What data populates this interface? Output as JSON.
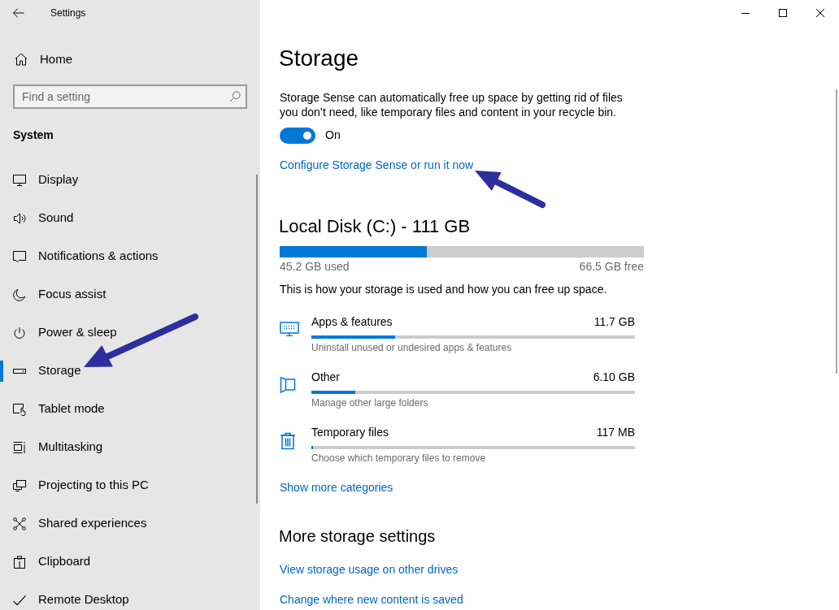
{
  "window": {
    "title": "Settings"
  },
  "sidebar": {
    "home": "Home",
    "search": {
      "placeholder": "Find a setting"
    },
    "section": "System",
    "items": [
      {
        "label": "Display",
        "selected": false
      },
      {
        "label": "Sound",
        "selected": false
      },
      {
        "label": "Notifications & actions",
        "selected": false
      },
      {
        "label": "Focus assist",
        "selected": false
      },
      {
        "label": "Power & sleep",
        "selected": false
      },
      {
        "label": "Storage",
        "selected": true
      },
      {
        "label": "Tablet mode",
        "selected": false
      },
      {
        "label": "Multitasking",
        "selected": false
      },
      {
        "label": "Projecting to this PC",
        "selected": false
      },
      {
        "label": "Shared experiences",
        "selected": false
      },
      {
        "label": "Clipboard",
        "selected": false
      },
      {
        "label": "Remote Desktop",
        "selected": false
      }
    ]
  },
  "page": {
    "title": "Storage",
    "description": "Storage Sense can automatically free up space by getting rid of files you don’t need, like temporary files and content in your recycle bin.",
    "storage_sense": {
      "on": true,
      "label": "On"
    },
    "configure_link": "Configure Storage Sense or run it now",
    "drive": {
      "title": "Local Disk (C:) - 111 GB",
      "level": 0.405,
      "used": "45.2 GB used",
      "free": "66.5 GB free"
    },
    "usage_note": "This is how your storage is used and how you can free up space.",
    "categories": [
      {
        "name": "Apps & features",
        "size": "11.7 GB",
        "level": 0.26,
        "description": "Uninstall unused or undesired apps & features"
      },
      {
        "name": "Other",
        "size": "6.10 GB",
        "level": 0.135,
        "description": "Manage other large folders"
      },
      {
        "name": "Temporary files",
        "size": "117 MB",
        "level": 0.005,
        "description": "Choose which temporary files to remove"
      }
    ],
    "show_more": "Show more categories",
    "more_settings": {
      "title": "More storage settings",
      "links": [
        "View storage usage on other drives",
        "Change where new content is saved"
      ]
    }
  }
}
